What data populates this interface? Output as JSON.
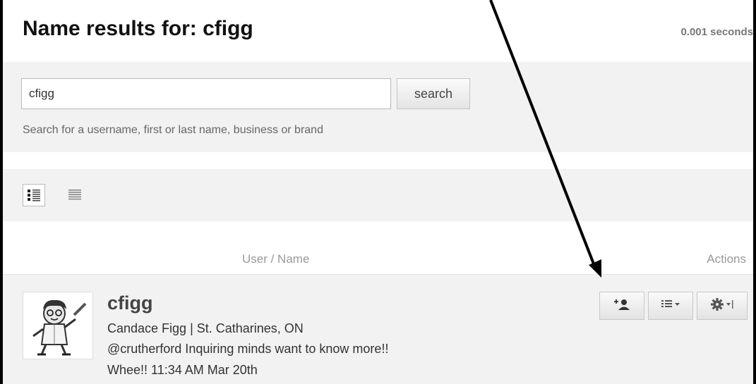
{
  "header": {
    "title": "Name results for: cfigg",
    "timing": "0.001 seconds"
  },
  "search": {
    "value": "cfigg",
    "button_label": "search",
    "hint": "Search for a username, first or last name, business or brand"
  },
  "view_toggle": {
    "icons": [
      "expanded-list-view-icon",
      "compact-list-view-icon"
    ],
    "selected": "expanded-list-view-icon"
  },
  "columns": {
    "user": "User / Name",
    "actions": "Actions"
  },
  "results": [
    {
      "username": "cfigg",
      "fullname": "Candace Figg | St. Catharines, ON",
      "status": "@crutherford Inquiring minds want to know more!!",
      "status_time": "Whee!!  11:34 AM Mar 20th",
      "avatar_icon": "cartoon-scientist-avatar",
      "actions": [
        "follow-user-icon",
        "add-to-list-icon",
        "settings-gear-icon"
      ]
    }
  ],
  "annotation": {
    "arrow_icon": "black-pointer-arrow",
    "color": "#000000"
  }
}
